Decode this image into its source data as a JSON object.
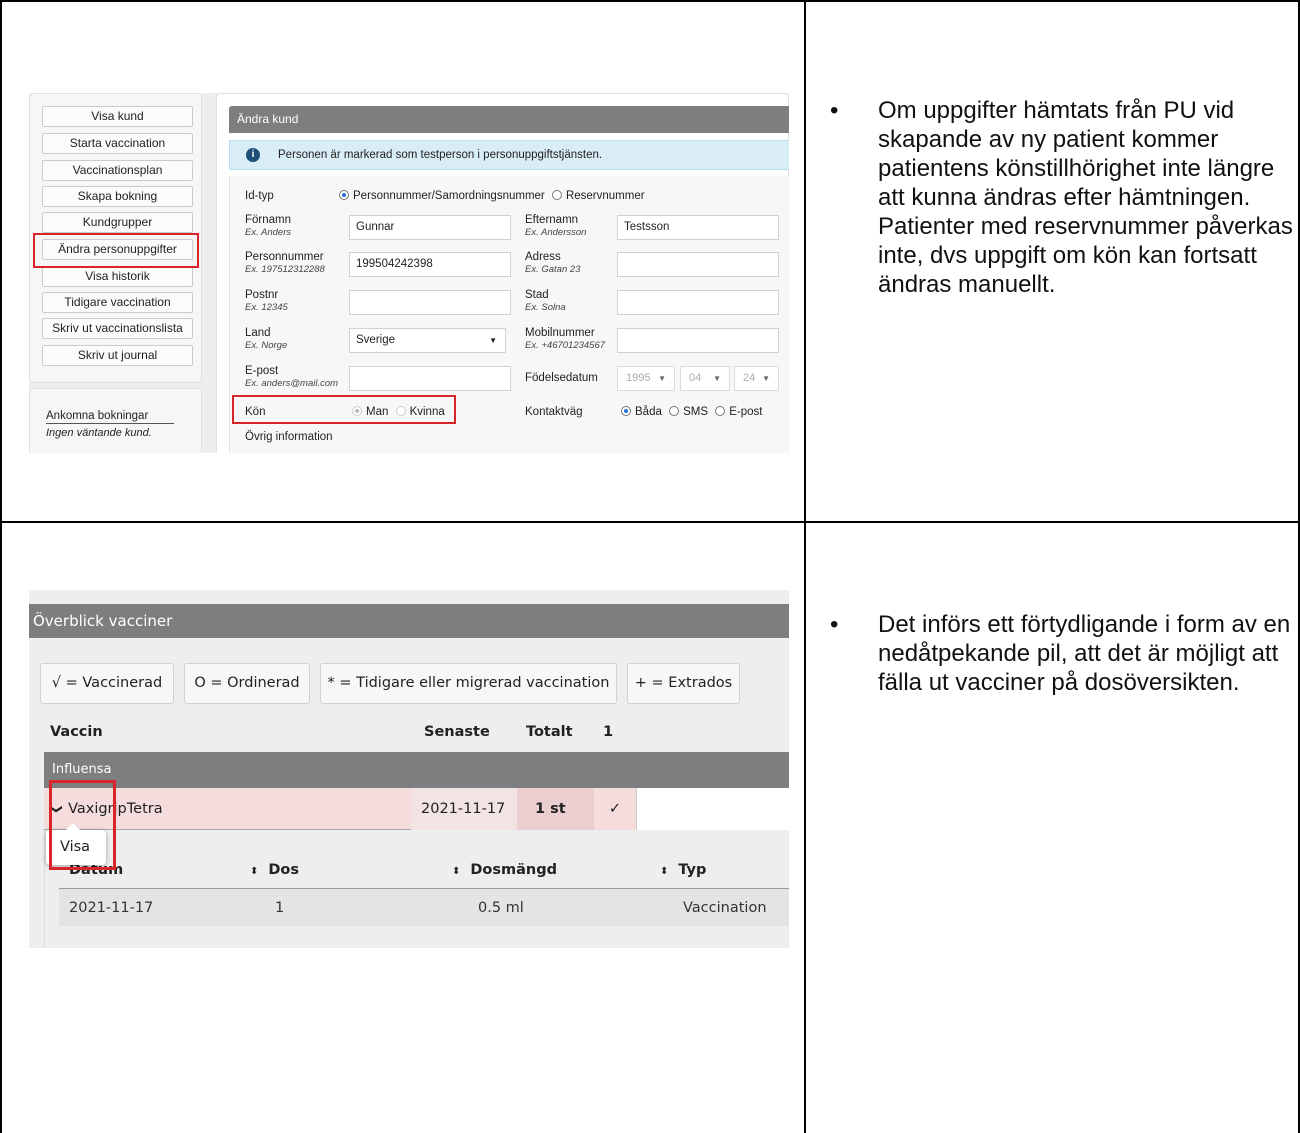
{
  "sidebar": {
    "buttons": [
      "Visa kund",
      "Starta vaccination",
      "Vaccinationsplan",
      "Skapa bokning",
      "Kundgrupper",
      "Ändra personuppgifter",
      "Visa historik",
      "Tidigare vaccination",
      "Skriv ut vaccinationslista",
      "Skriv ut journal"
    ],
    "arrivals_title": "Ankomna bokningar",
    "arrivals_empty": "Ingen väntande kund."
  },
  "form": {
    "header": "Ändra kund",
    "info_message": "Personen är markerad som testperson i personuppgiftstjänsten.",
    "id_type_label": "Id-typ",
    "id_type_options": [
      "Personnummer/Samordningsnummer",
      "Reservnummer"
    ],
    "first_name_label": "Förnamn",
    "first_name_example": "Ex. Anders",
    "first_name_value": "Gunnar",
    "last_name_label": "Efternamn",
    "last_name_example": "Ex. Andersson",
    "last_name_value": "Testsson",
    "pnr_label": "Personnummer",
    "pnr_example": "Ex. 197512312288",
    "pnr_value": "199504242398",
    "address_label": "Adress",
    "address_example": "Ex. Gatan 23",
    "zip_label": "Postnr",
    "zip_example": "Ex. 12345",
    "city_label": "Stad",
    "city_example": "Ex. Solna",
    "country_label": "Land",
    "country_example": "Ex. Norge",
    "country_value": "Sverige",
    "mobile_label": "Mobilnummer",
    "mobile_example": "Ex. +46701234567",
    "email_label": "E-post",
    "email_example": "Ex. anders@mail.com",
    "birth_label": "Födelsedatum",
    "birth_year": "1995",
    "birth_month": "04",
    "birth_day": "24",
    "gender_label": "Kön",
    "gender_options": [
      "Man",
      "Kvinna"
    ],
    "contact_label": "Kontaktväg",
    "contact_options": [
      "Båda",
      "SMS",
      "E-post"
    ],
    "other_info_label": "Övrig information"
  },
  "overview": {
    "header": "Överblick vacciner",
    "legend": [
      "√ = Vaccinerad",
      "O = Ordinerad",
      "* = Tidigare eller migrerad vaccination",
      "+ = Extrados"
    ],
    "columns": {
      "vaccine": "Vaccin",
      "latest": "Senaste",
      "total": "Totalt",
      "total_count": "1"
    },
    "group": "Influensa",
    "row": {
      "name": "VaxigripTetra",
      "date": "2021-11-17",
      "count": "1 st",
      "check": "✓"
    },
    "tooltip": "Visa",
    "detail_columns": [
      "Datum",
      "Dos",
      "Dosmängd",
      "Typ"
    ],
    "detail_row": {
      "date": "2021-11-17",
      "dose": "1",
      "amount": "0.5 ml",
      "type": "Vaccination"
    }
  },
  "notes": [
    "Om uppgifter hämtats från PU vid skapande av ny patient kommer patientens könstillhörighet inte längre att kunna ändras efter hämtningen. Patienter med reservnummer påverkas inte, dvs uppgift om kön kan fortsatt ändras manuellt.",
    "Det införs ett förtydligande i form av en nedåtpekande pil, att det är möjligt att fälla ut vacciner på dosöversikten."
  ],
  "colors": {
    "highlight_red": "#d9252a",
    "header_gray": "#7c7e80",
    "info_blue": "#d9edf7",
    "row_pink": "#f5dcdd"
  }
}
